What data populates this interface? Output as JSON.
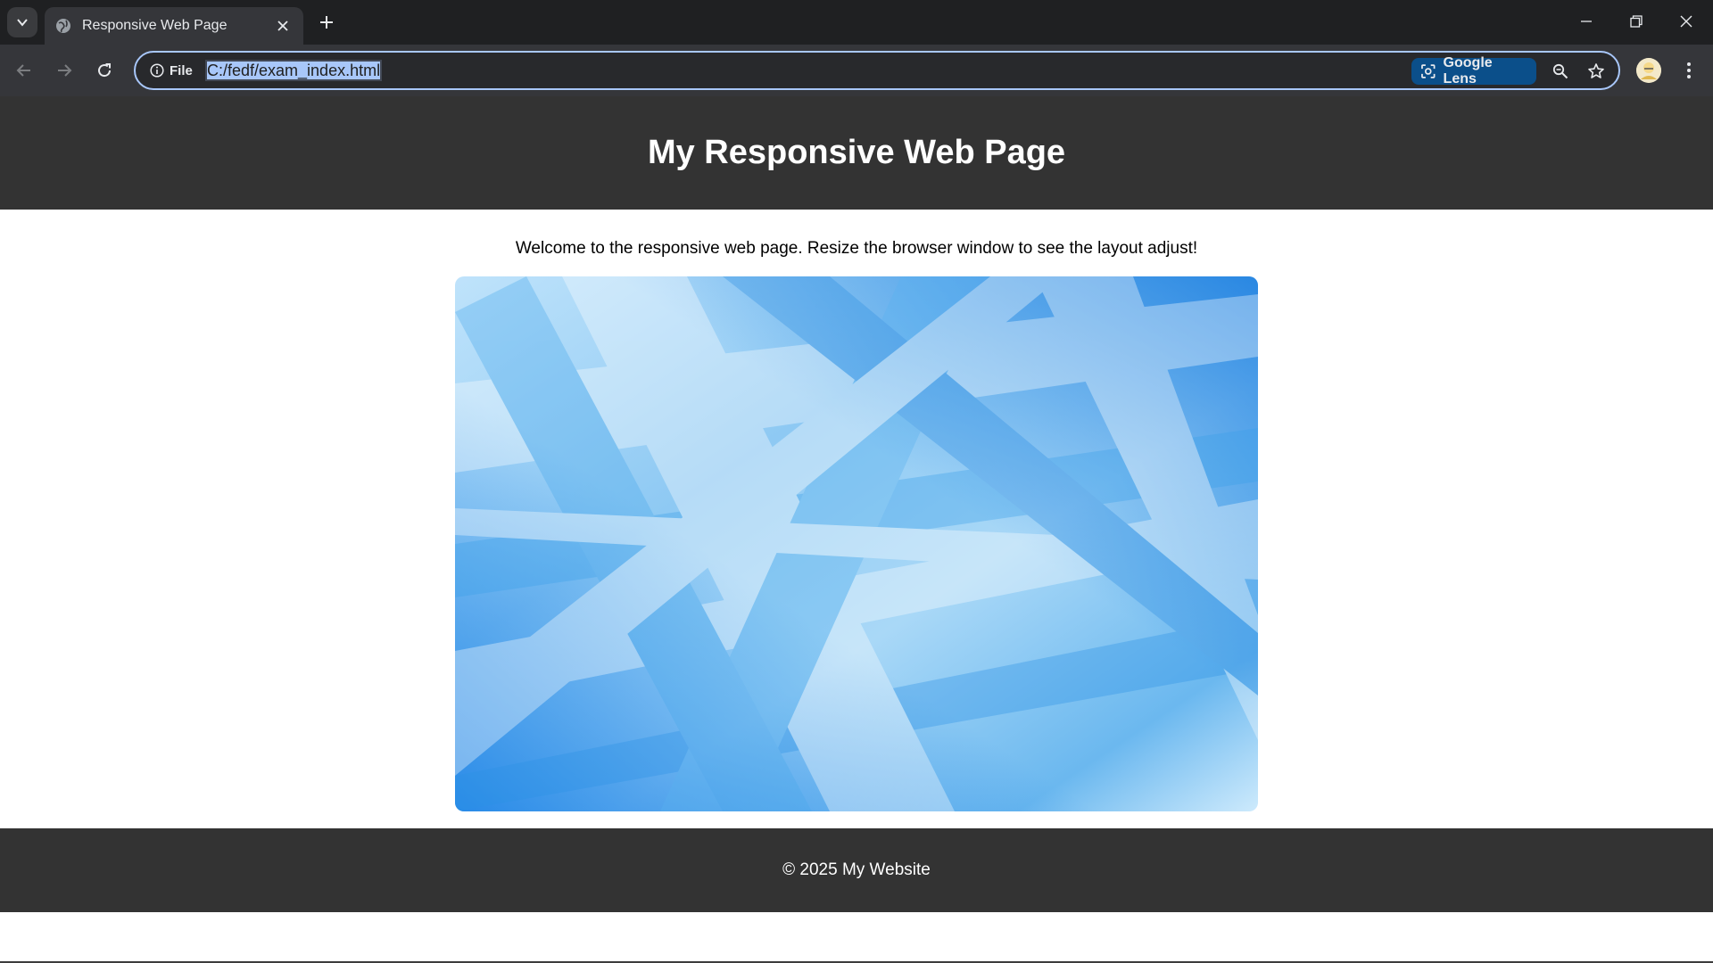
{
  "browser": {
    "tab": {
      "title": "Responsive Web Page"
    },
    "address_bar": {
      "site_info_label": "File",
      "url": "C:/fedf/exam_index.html"
    },
    "lens_label": "Google Lens",
    "accent_color": "#a8c7fa"
  },
  "page": {
    "header": {
      "title": "My Responsive Web Page"
    },
    "intro_text": "Welcome to the responsive web page. Resize the browser window to see the layout adjust!",
    "hero_image": {
      "description_icon": "abstract-blue-background-image"
    },
    "footer": {
      "text": "© 2025 My Website"
    },
    "colors": {
      "header_bg": "#333333",
      "footer_bg": "#333333",
      "text": "#ffffff"
    }
  }
}
